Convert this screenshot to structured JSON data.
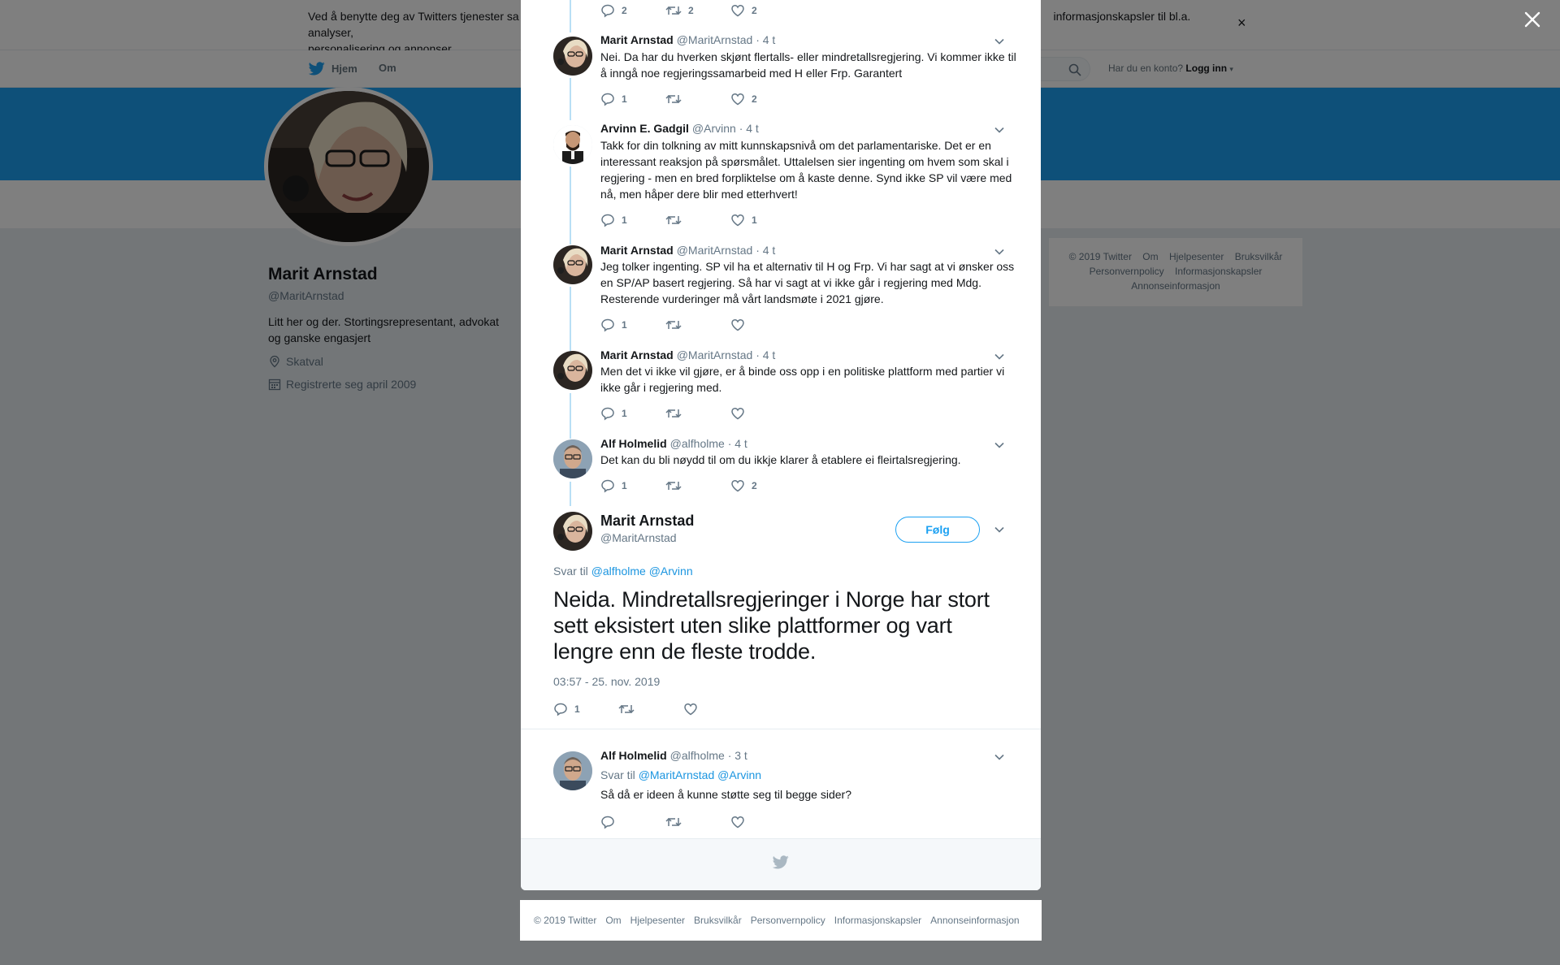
{
  "cookie_banner": {
    "text": "Ved å benytte deg av Twitters tjenester sa… informasjonskapsler til bl.a. analyser, personalisering og annonser.",
    "text_left": "Ved å benytte deg av Twitters tjenester sa",
    "text_right": "informasjonskapsler til bl.a. analyser,",
    "text_line2": "personalisering og annonser.",
    "close": "×"
  },
  "nav": {
    "home": "Hjem",
    "about": "Om",
    "login_prompt": "Har du en konto?",
    "login": "Logg inn"
  },
  "profile": {
    "name": "Marit Arnstad",
    "handle": "@MaritArnstad",
    "bio": "Litt her og der. Stortingsrepresentant, advokat og ganske engasjert",
    "location": "Skatval",
    "joined": "Registrerte seg april 2009"
  },
  "side_footer": {
    "line1": [
      "© 2019 Twitter",
      "Om",
      "Hjelpesenter",
      "Bruksvilkår"
    ],
    "line2": [
      "Personvernpolicy",
      "Informasjonskapsler"
    ],
    "line3": [
      "Annonseinformasjon"
    ]
  },
  "thread": {
    "top_actions": {
      "replies": "2",
      "retweets": "2",
      "likes": "2"
    },
    "tweets": [
      {
        "name": "Marit Arnstad",
        "handle": "@MaritArnstad",
        "time": "· 4 t",
        "text": "Nei. Da har du hverken skjønt flertalls- eller mindretallsregjering. Vi kommer ikke til å inngå noe regjeringssamarbeid med H eller Frp. Garantert",
        "replies": "1",
        "retweets": "",
        "likes": "2"
      },
      {
        "name": "Arvinn E. Gadgil",
        "handle": "@Arvinn",
        "time": "· 4 t",
        "text": "Takk for din tolkning av mitt kunnskapsnivå om det parlamentariske. Det er en interessant reaksjon på spørsmålet. Uttalelsen sier ingenting om hvem som skal i regjering - men en bred forpliktelse om å kaste denne. Synd ikke SP vil være med nå, men håper dere blir med etterhvert!",
        "replies": "1",
        "retweets": "",
        "likes": "1"
      },
      {
        "name": "Marit Arnstad",
        "handle": "@MaritArnstad",
        "time": "· 4 t",
        "text": "Jeg tolker ingenting. SP vil ha et alternativ til H og Frp. Vi har sagt at vi ønsker oss en SP/AP basert regjering. Så har vi sagt at vi ikke går i regjering med Mdg. Resterende vurderinger må vårt landsmøte i 2021 gjøre.",
        "replies": "1",
        "retweets": "",
        "likes": ""
      },
      {
        "name": "Marit Arnstad",
        "handle": "@MaritArnstad",
        "time": "· 4 t",
        "text": "Men det vi ikke vil gjøre, er å binde oss opp i en politiske plattform med partier vi ikke går i regjering med.",
        "replies": "1",
        "retweets": "",
        "likes": ""
      },
      {
        "name": "Alf Holmelid",
        "handle": "@alfholme",
        "time": "· 4 t",
        "text": "Det kan du bli nøydd til om du ikkje klarer å etablere ei fleirtalsregjering.",
        "replies": "1",
        "retweets": "",
        "likes": "2"
      }
    ],
    "main": {
      "name": "Marit Arnstad",
      "handle": "@MaritArnstad",
      "follow": "Følg",
      "reply_to_prefix": "Svar til",
      "reply_to_1": "@alfholme",
      "reply_to_2": "@Arvinn",
      "text": "Neida. Mindretallsregjeringer i Norge har stort sett eksistert uten slike plattformer og vart lengre enn de fleste trodde.",
      "timestamp": "03:57 - 25. nov. 2019",
      "replies": "1",
      "retweets": "",
      "likes": ""
    },
    "reply": {
      "name": "Alf Holmelid",
      "handle": "@alfholme",
      "time": "· 3 t",
      "reply_to_prefix": "Svar til",
      "reply_to_1": "@MaritArnstad",
      "reply_to_2": "@Arvinn",
      "text": "Så då er ideen å kunne støtte seg til begge sider?",
      "replies": "",
      "retweets": "",
      "likes": ""
    }
  },
  "bottom_footer": [
    "© 2019 Twitter",
    "Om",
    "Hjelpesenter",
    "Bruksvilkår",
    "Personvernpolicy",
    "Informasjonskapsler",
    "Annonseinformasjon"
  ],
  "colors": {
    "brand": "#1da1f2",
    "link": "#1b95e0",
    "thread_line": "#b9dff5",
    "overlay": "rgba(0,0,0,0.5)"
  }
}
